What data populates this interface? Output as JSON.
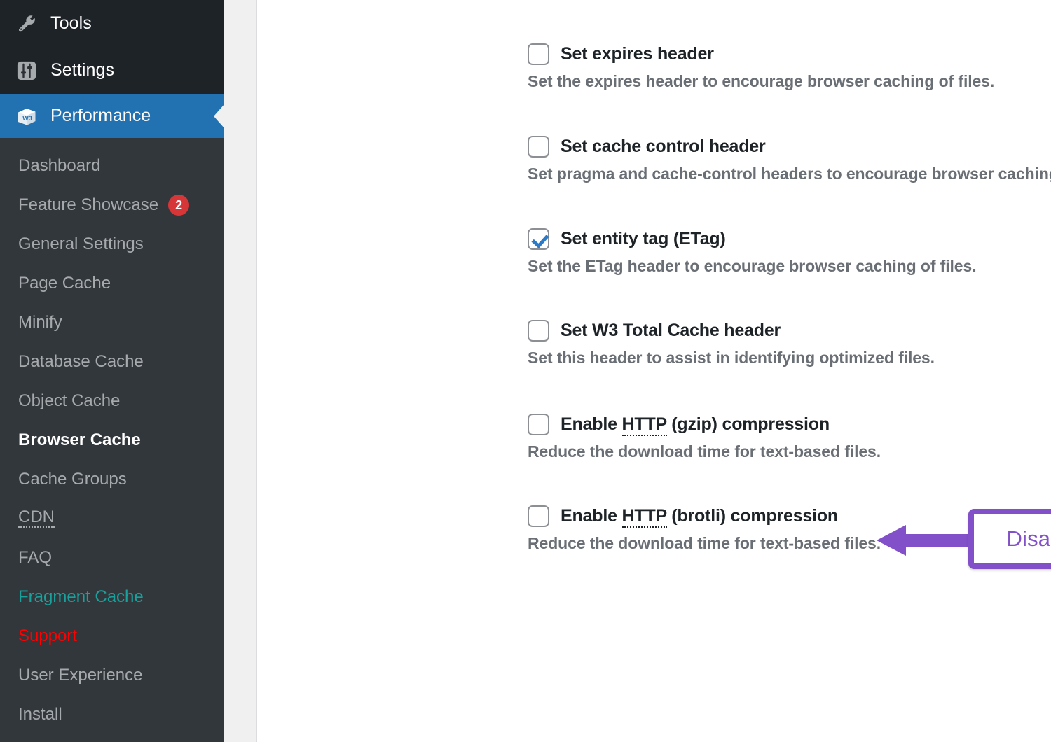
{
  "sidebar": {
    "top_items": [
      {
        "label": "Tools",
        "icon": "wrench-icon"
      },
      {
        "label": "Settings",
        "icon": "sliders-icon"
      }
    ],
    "active_parent": {
      "label": "Performance",
      "icon": "w3-cube-icon",
      "icon_text": "W3"
    },
    "submenu": [
      {
        "label": "Dashboard",
        "state": "normal"
      },
      {
        "label": "Feature Showcase",
        "state": "normal",
        "badge": "2"
      },
      {
        "label": "General Settings",
        "state": "normal"
      },
      {
        "label": "Page Cache",
        "state": "normal"
      },
      {
        "label": "Minify",
        "state": "normal"
      },
      {
        "label": "Database Cache",
        "state": "normal"
      },
      {
        "label": "Object Cache",
        "state": "normal"
      },
      {
        "label": "Browser Cache",
        "state": "current"
      },
      {
        "label": "Cache Groups",
        "state": "normal"
      },
      {
        "label": "CDN",
        "state": "normal",
        "abbr": true
      },
      {
        "label": "FAQ",
        "state": "normal"
      },
      {
        "label": "Fragment Cache",
        "state": "teal"
      },
      {
        "label": "Support",
        "state": "red"
      },
      {
        "label": "User Experience",
        "state": "normal"
      },
      {
        "label": "Install",
        "state": "normal"
      }
    ]
  },
  "main": {
    "options": [
      {
        "title": "Set expires header",
        "title_prefix": "",
        "abbr": "",
        "title_suffix": "",
        "description": "Set the expires header to encourage browser caching of files.",
        "checked": false
      },
      {
        "title": "Set cache control header",
        "title_prefix": "",
        "abbr": "",
        "title_suffix": "",
        "description": "Set pragma and cache-control headers to encourage browser caching of files.",
        "checked": false
      },
      {
        "title": "Set entity tag (ETag)",
        "title_prefix": "",
        "abbr": "",
        "title_suffix": "",
        "description": "Set the ETag header to encourage browser caching of files.",
        "checked": true
      },
      {
        "title": "Set W3 Total Cache header",
        "title_prefix": "",
        "abbr": "",
        "title_suffix": "",
        "description": "Set this header to assist in identifying optimized files.",
        "checked": false
      },
      {
        "title": "Enable HTTP (gzip) compression",
        "title_prefix": "Enable ",
        "abbr": "HTTP",
        "title_suffix": " (gzip) compression",
        "description": "Reduce the download time for text-based files.",
        "checked": false
      },
      {
        "title": "Enable HTTP (brotli) compression",
        "title_prefix": "Enable ",
        "abbr": "HTTP",
        "title_suffix": " (brotli) compression",
        "description": "Reduce the download time for text-based files.",
        "checked": false
      }
    ]
  },
  "annotation": {
    "text": "Disable this option",
    "color": "#8250c8",
    "arrow_direction": "left"
  },
  "colors": {
    "sidebar_top_bg": "#1d2327",
    "sidebar_submenu_bg": "#32373c",
    "accent_blue": "#2271b1",
    "badge_red": "#d63638",
    "teal": "#1aa19c",
    "support_red": "#ff0000",
    "checkbox_check": "#2a7ac8",
    "annotation_purple": "#8250c8",
    "gutter": "#f0f0f1"
  }
}
